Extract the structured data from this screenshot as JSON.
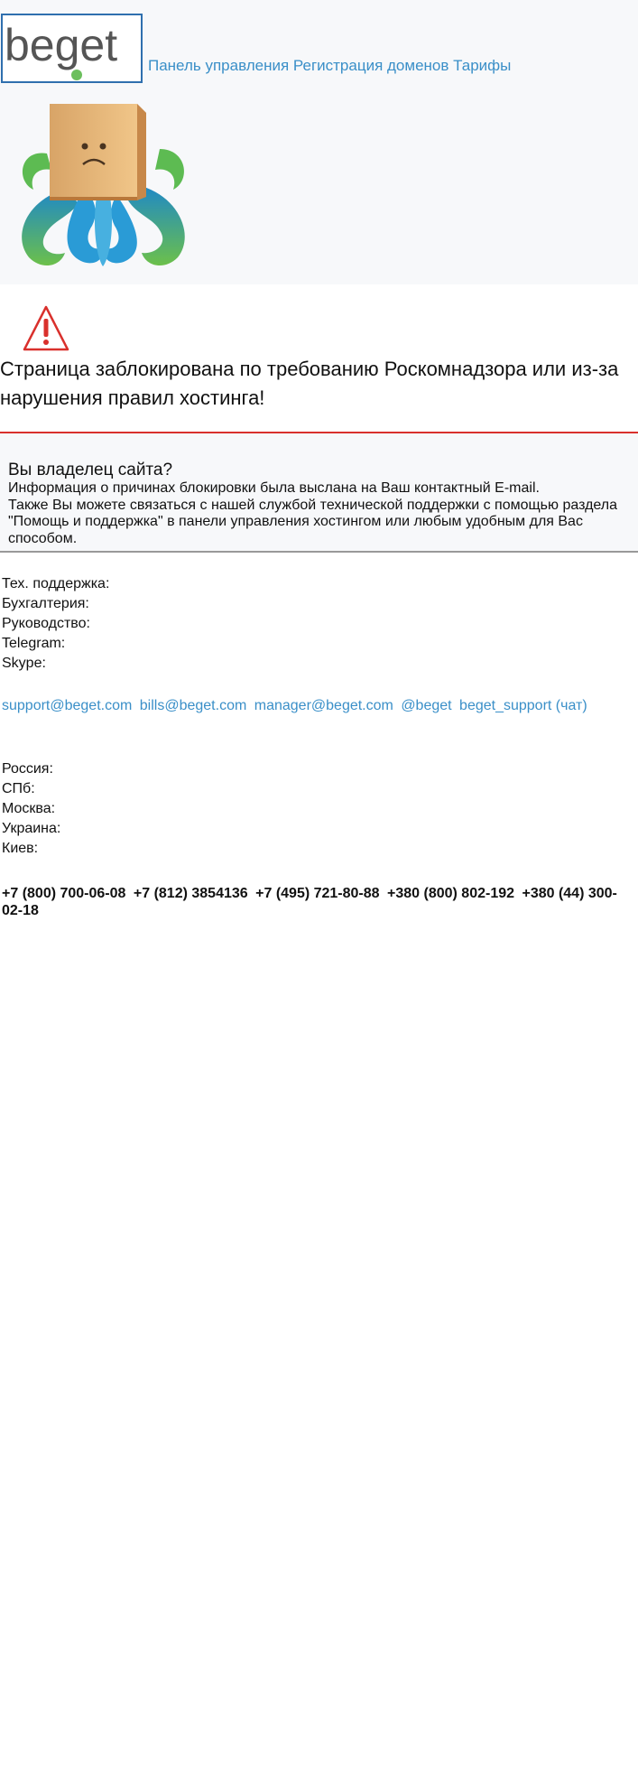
{
  "logo": {
    "text": "beget"
  },
  "nav": {
    "items": [
      {
        "label": "Панель управления"
      },
      {
        "label": "Регистрация доменов"
      },
      {
        "label": "Тарифы"
      }
    ]
  },
  "blocked": {
    "title": "Страница заблокирована по требованию Роскомнадзора или из-за нарушения правил хостинга!"
  },
  "owner": {
    "title": "Вы владелец сайта?",
    "line1": "Информация о причинах блокировки была выслана на Ваш контактный E-mail.",
    "line2": "Также Вы можете связаться с нашей службой технической поддержки с помощью раздела \"Помощь и поддержка\" в панели управления хостингом или любым удобным для Вас способом."
  },
  "contacts": {
    "labels": [
      "Тех. поддержка:",
      "Бухгалтерия:",
      "Руководство:",
      "Telegram:",
      "Skype:"
    ],
    "values": [
      "support@beget.com",
      "bills@beget.com",
      "manager@beget.com",
      "@beget",
      "beget_support (чат)"
    ]
  },
  "regions": {
    "labels": [
      "Россия:",
      "СПб:",
      "Москва:",
      "Украина:",
      "Киев:"
    ],
    "phones": [
      "+7 (800) 700-06-08",
      "+7 (812) 3854136",
      "+7 (495) 721-80-88",
      "+380 (800) 802-192",
      "+380 (44) 300-02-18"
    ]
  },
  "colors": {
    "link": "#3a8fc8",
    "accent_red": "#d9302c",
    "header_bg": "#f7f8fa",
    "logo_border": "#2f6fae"
  }
}
